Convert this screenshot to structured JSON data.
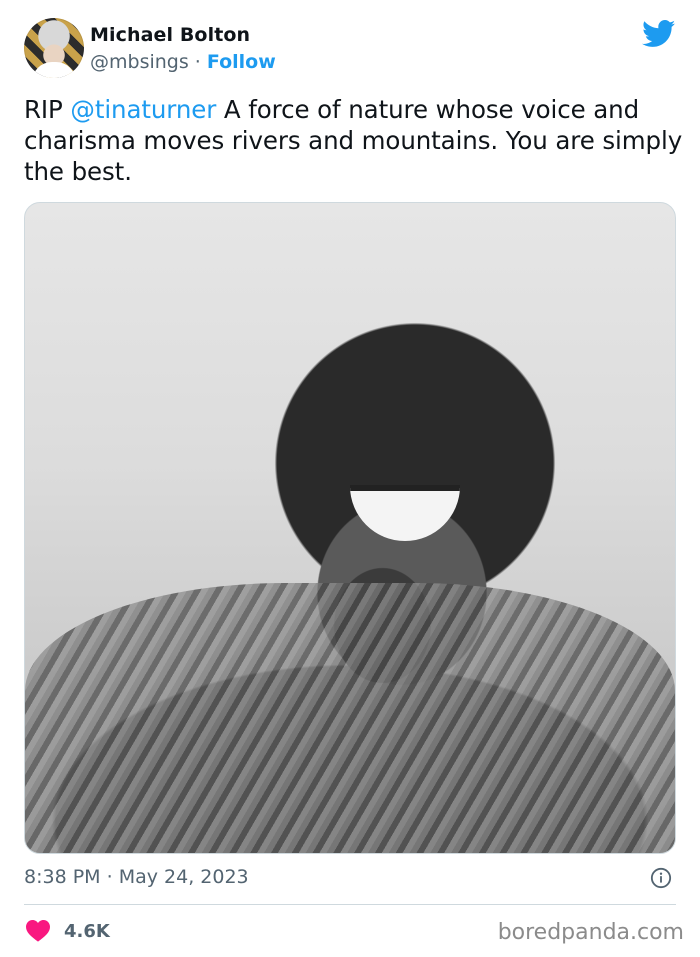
{
  "author": {
    "name": "Michael Bolton",
    "handle": "@mbsings",
    "separator": "·",
    "follow_label": "Follow"
  },
  "tweet": {
    "text_prefix": "RIP ",
    "mention": "@tinaturner",
    "text_rest": " A force of nature whose voice and charisma moves rivers and mountains. You are simply the best."
  },
  "meta": {
    "time": "8:38 PM",
    "separator": "·",
    "date": "May 24, 2023"
  },
  "engagement": {
    "likes": "4.6K"
  },
  "watermark": "boredpanda.com",
  "colors": {
    "accent": "#1d9bf0",
    "like": "#f91880",
    "muted": "#536471"
  },
  "icons": [
    "twitter-bird-icon",
    "info-icon",
    "heart-icon"
  ]
}
